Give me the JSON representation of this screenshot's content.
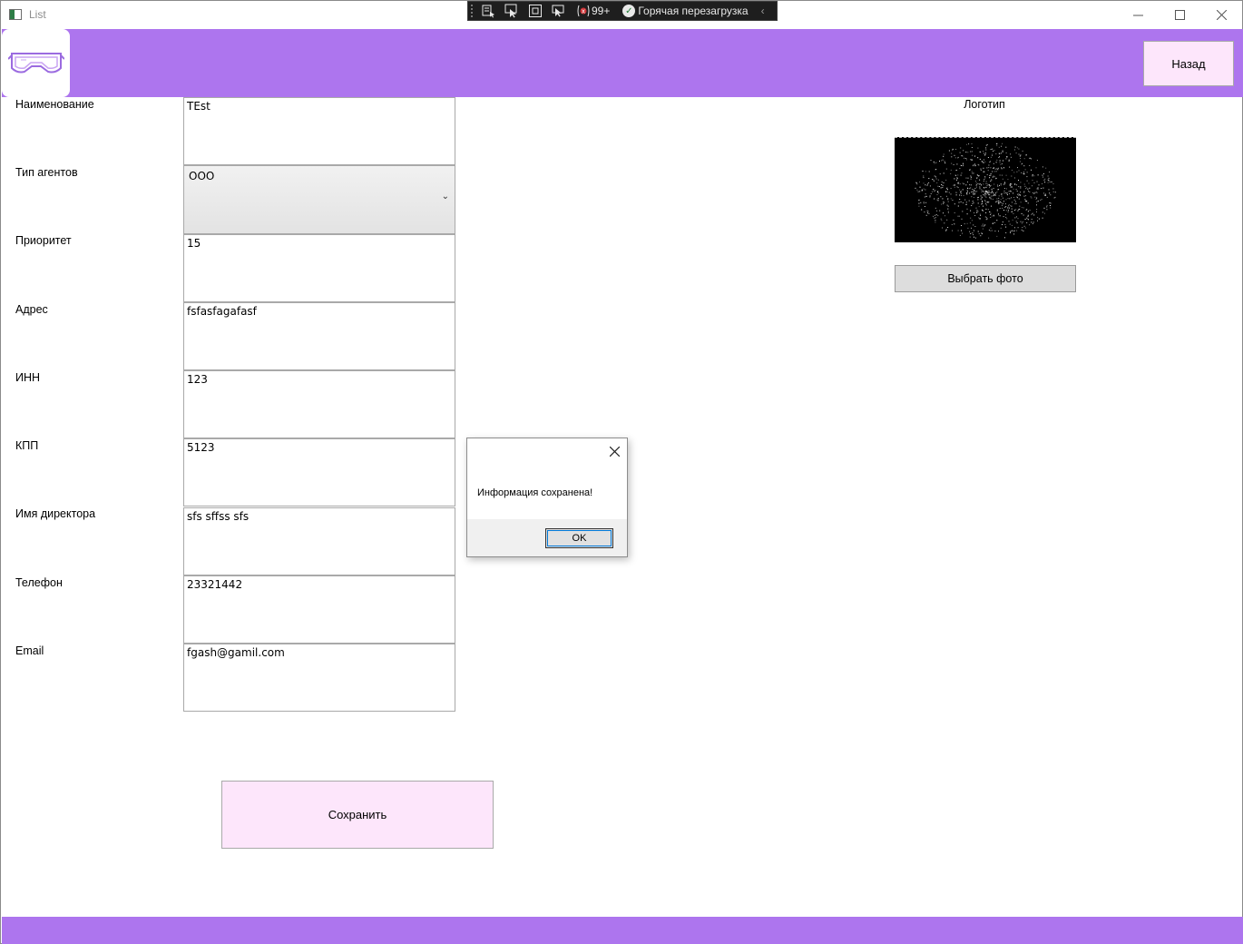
{
  "window": {
    "title": "List",
    "controls": [
      "minimize-icon",
      "maximize-icon",
      "close-icon"
    ]
  },
  "debug_toolbar": {
    "icons": [
      "select-element-icon",
      "pointer-icon",
      "layout-adorner-icon",
      "track-focus-icon"
    ],
    "issues_count": "99+",
    "hot_reload_label": "Горячая перезагрузка"
  },
  "header": {
    "logo_icon": "vr-headset-logo",
    "back_label": "Назад"
  },
  "form": {
    "name": {
      "label": "Наименование",
      "value": "TEst"
    },
    "agent_type": {
      "label": "Тип агентов",
      "value": "ООО"
    },
    "priority": {
      "label": "Приоритет",
      "value": "15"
    },
    "address": {
      "label": "Адрес",
      "value": "fsfasfagafasf"
    },
    "inn": {
      "label": "ИНН",
      "value": "123"
    },
    "kpp": {
      "label": "КПП",
      "value": "5123"
    },
    "director": {
      "label": "Имя директора",
      "value": "sfs sffss sfs"
    },
    "phone": {
      "label": "Телефон",
      "value": "23321442"
    },
    "email": {
      "label": "Email",
      "value": "fgash@gamil.com"
    },
    "save_label": "Сохранить"
  },
  "logo_panel": {
    "title": "Логотип",
    "choose_label": "Выбрать фото"
  },
  "message_box": {
    "text": "Информация сохранена!",
    "ok_label": "OK"
  },
  "colors": {
    "accent": "#ad75ee",
    "button_bg": "#fde6fb"
  }
}
